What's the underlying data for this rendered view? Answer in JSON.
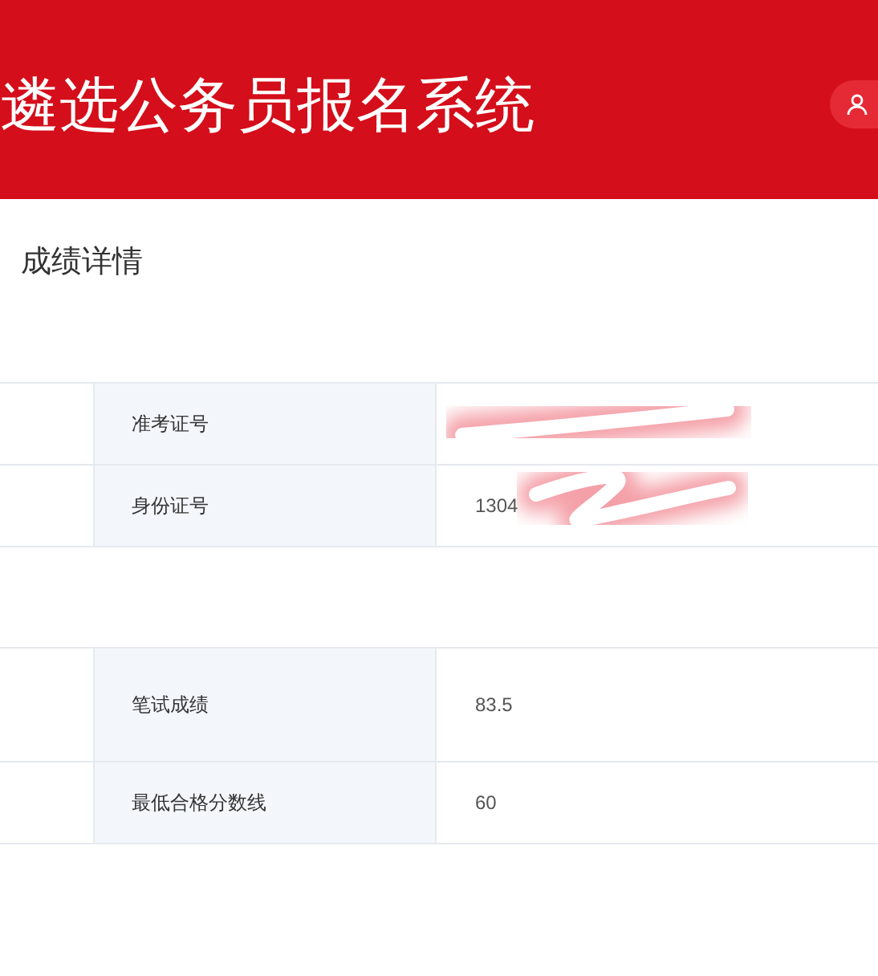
{
  "header": {
    "title": "遴选公务员报名系统"
  },
  "section": {
    "title": "成绩详情"
  },
  "tables": [
    {
      "rows": [
        {
          "label": "准考证号",
          "redacted": true
        },
        {
          "label": "身份证号",
          "value": "1304",
          "redacted": true
        }
      ]
    },
    {
      "rows": [
        {
          "label": "笔试成绩",
          "value": "83.5"
        },
        {
          "label": "最低合格分数线",
          "value": "60"
        }
      ]
    }
  ]
}
